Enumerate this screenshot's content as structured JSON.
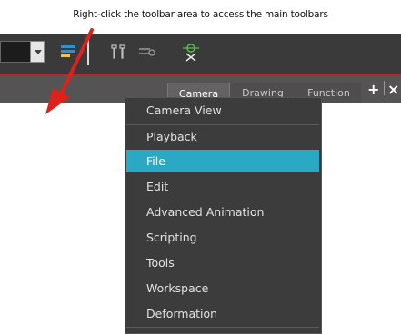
{
  "annotation": {
    "text": "Right-click the toolbar area to access the main toolbars"
  },
  "tabs": [
    {
      "label": "Camera",
      "active": true
    },
    {
      "label": "Drawing",
      "active": false
    },
    {
      "label": "Function",
      "active": false
    }
  ],
  "tab_actions": {
    "add": "+",
    "close": "×"
  },
  "context_menu": {
    "items": [
      {
        "label": "Camera View"
      },
      {
        "label": "Playback"
      },
      {
        "label": "File",
        "selected": true
      },
      {
        "label": "Edit"
      },
      {
        "label": "Advanced Animation"
      },
      {
        "label": "Scripting"
      },
      {
        "label": "Tools"
      },
      {
        "label": "Workspace"
      },
      {
        "label": "Deformation"
      }
    ]
  },
  "colors": {
    "toolbar_bg": "#3a3a3a",
    "panel_bg": "#545454",
    "menu_bg": "#3c3c3c",
    "menu_highlight": "#2aa9c4",
    "separator_red": "#b8262b",
    "annotation_arrow": "#e0211b"
  },
  "icons": [
    "dropdown-chevron-icon",
    "layer-stack-icon",
    "tools-icon",
    "settings-sliders-icon",
    "pivot-target-icon",
    "red-arrow-annotation"
  ]
}
